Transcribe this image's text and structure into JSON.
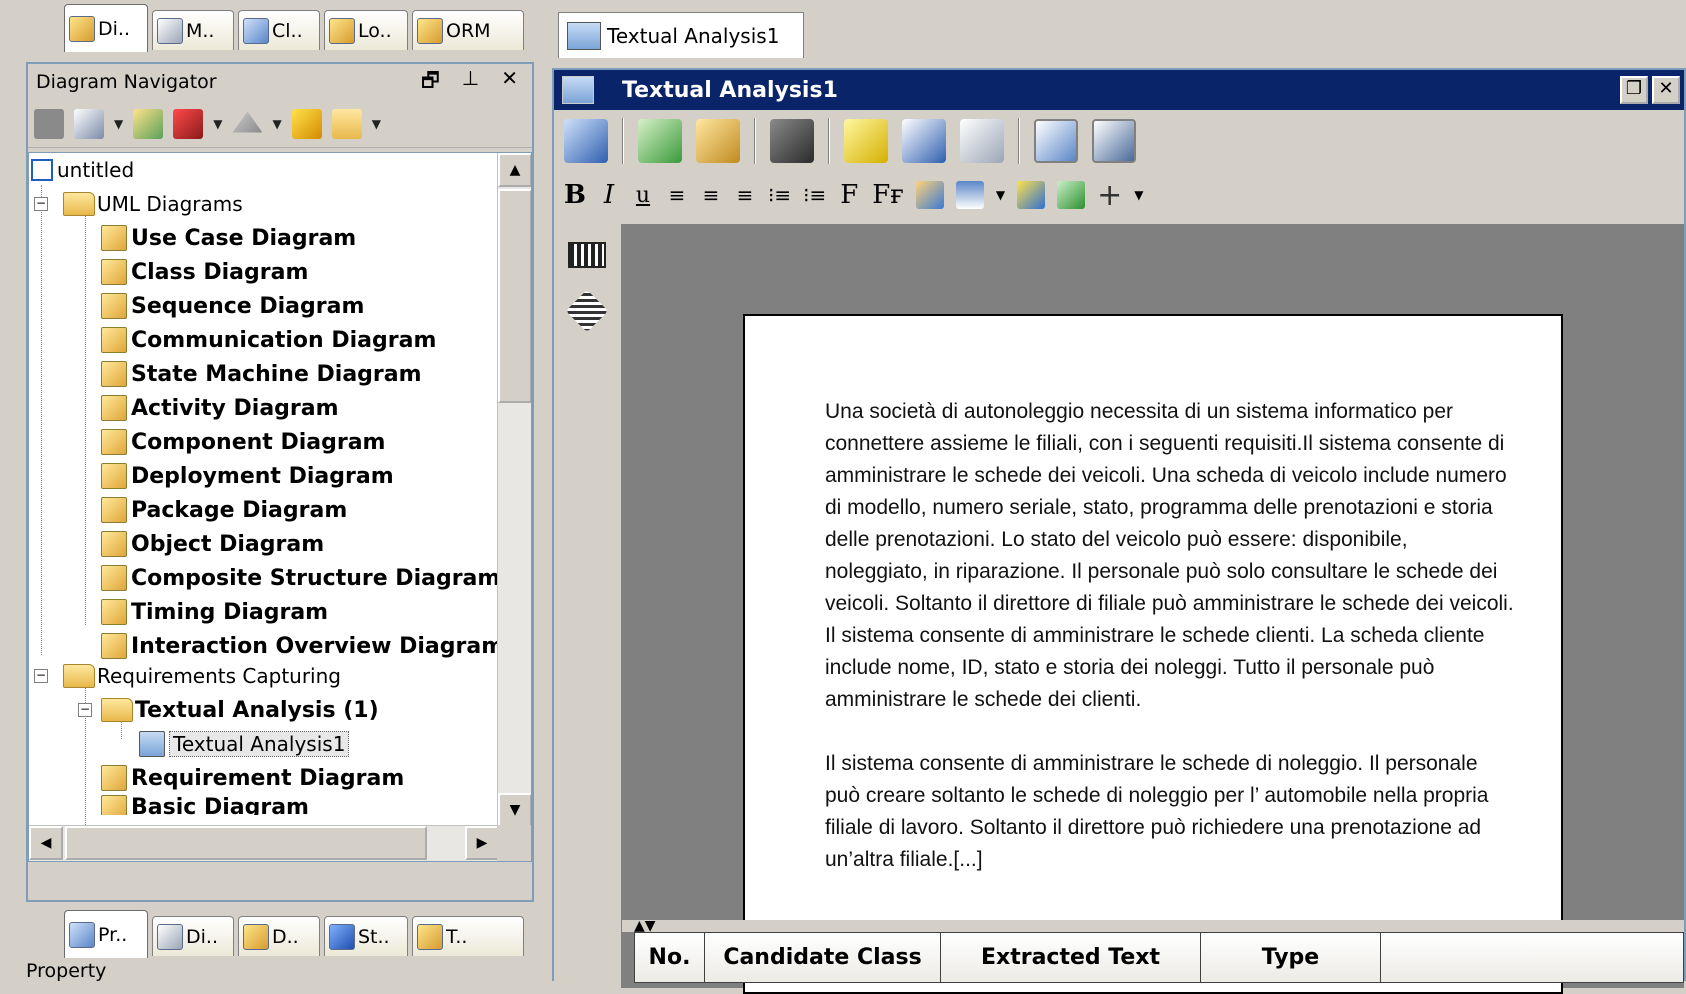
{
  "left_tabs": [
    {
      "label": "Di.."
    },
    {
      "label": "M.."
    },
    {
      "label": "Cl.."
    },
    {
      "label": "Lo.."
    },
    {
      "label": "ORM"
    }
  ],
  "navigator": {
    "title": "Diagram Navigator",
    "title_buttons": [
      "🗗",
      "⊥",
      "✕"
    ],
    "tree": {
      "root": "untitled",
      "uml_folder": "UML Diagrams",
      "uml_items": [
        "Use Case Diagram",
        "Class Diagram",
        "Sequence Diagram",
        "Communication Diagram",
        "State Machine Diagram",
        "Activity Diagram",
        "Component Diagram",
        "Deployment Diagram",
        "Package Diagram",
        "Object Diagram",
        "Composite Structure Diagram",
        "Timing Diagram",
        "Interaction Overview Diagram"
      ],
      "req_folder": "Requirements Capturing",
      "textual_folder": "Textual Analysis (1)",
      "textual_child": "Textual Analysis1",
      "requirement_item": "Requirement Diagram",
      "partial_item": "Basic Diagram"
    }
  },
  "bottom_tabs": [
    {
      "label": "Pr.."
    },
    {
      "label": "Di.."
    },
    {
      "label": "D.."
    },
    {
      "label": "St.."
    },
    {
      "label": "T.."
    }
  ],
  "property_title": "Property",
  "doc_tab": {
    "label": "Textual Analysis1"
  },
  "editor": {
    "title": "Textual Analysis1",
    "format_bar": [
      "B",
      "I",
      "u",
      "≡",
      "≡",
      "≡",
      "⁝≡",
      "⁝≡",
      "F",
      "Fғ"
    ],
    "page_paragraphs": [
      "Una società di autonoleggio necessita di un sistema informatico per connettere assieme le filiali, con i seguenti requisiti.Il sistema consente di amministrare le schede dei veicoli. Una scheda di veicolo include numero di modello, numero seriale, stato, programma delle prenotazioni e storia delle prenotazioni. Lo stato del veicolo può essere: disponibile, noleggiato, in riparazione. Il personale può solo consultare le schede dei veicoli. Soltanto il direttore di filiale può amministrare le schede dei veicoli. Il sistema consente di amministrare le schede clienti. La scheda cliente include nome, ID, stato e storia dei noleggi. Tutto il personale può amministrare le schede dei clienti.",
      "Il sistema consente di amministrare le schede di noleggio. Il personale può creare soltanto le schede di noleggio per l’ automobile nella propria filiale di lavoro. Soltanto il direttore può richiedere una prenotazione ad un’altra filiale.[...]"
    ],
    "grid_columns": [
      "No.",
      "Candidate Class",
      "Extracted Text",
      "Type",
      ""
    ]
  }
}
